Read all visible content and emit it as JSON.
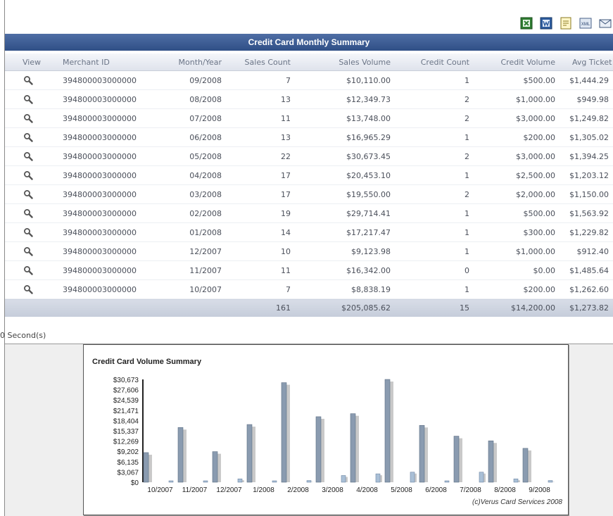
{
  "report": {
    "title": "Credit Card Monthly Summary",
    "elapsed": "0 Second(s)"
  },
  "toolbar": {
    "icons": [
      "excel-icon",
      "word-icon",
      "document-icon",
      "xml-icon",
      "email-icon"
    ],
    "xml_label": "XML"
  },
  "table": {
    "headers": {
      "view": "View",
      "merchant_id": "Merchant ID",
      "month_year": "Month/Year",
      "sales_count": "Sales Count",
      "sales_volume": "Sales Volume",
      "credit_count": "Credit Count",
      "credit_volume": "Credit Volume",
      "avg_ticket": "Avg Ticket"
    },
    "rows": [
      {
        "merchant": "394800003000000",
        "month": "09/2008",
        "sales_count": "7",
        "sales_volume": "$10,110.00",
        "credit_count": "1",
        "credit_volume": "$500.00",
        "avg": "$1,444.29"
      },
      {
        "merchant": "394800003000000",
        "month": "08/2008",
        "sales_count": "13",
        "sales_volume": "$12,349.73",
        "credit_count": "2",
        "credit_volume": "$1,000.00",
        "avg": "$949.98"
      },
      {
        "merchant": "394800003000000",
        "month": "07/2008",
        "sales_count": "11",
        "sales_volume": "$13,748.00",
        "credit_count": "2",
        "credit_volume": "$3,000.00",
        "avg": "$1,249.82"
      },
      {
        "merchant": "394800003000000",
        "month": "06/2008",
        "sales_count": "13",
        "sales_volume": "$16,965.29",
        "credit_count": "1",
        "credit_volume": "$200.00",
        "avg": "$1,305.02"
      },
      {
        "merchant": "394800003000000",
        "month": "05/2008",
        "sales_count": "22",
        "sales_volume": "$30,673.45",
        "credit_count": "2",
        "credit_volume": "$3,000.00",
        "avg": "$1,394.25"
      },
      {
        "merchant": "394800003000000",
        "month": "04/2008",
        "sales_count": "17",
        "sales_volume": "$20,453.10",
        "credit_count": "1",
        "credit_volume": "$2,500.00",
        "avg": "$1,203.12"
      },
      {
        "merchant": "394800003000000",
        "month": "03/2008",
        "sales_count": "17",
        "sales_volume": "$19,550.00",
        "credit_count": "2",
        "credit_volume": "$2,000.00",
        "avg": "$1,150.00"
      },
      {
        "merchant": "394800003000000",
        "month": "02/2008",
        "sales_count": "19",
        "sales_volume": "$29,714.41",
        "credit_count": "1",
        "credit_volume": "$500.00",
        "avg": "$1,563.92"
      },
      {
        "merchant": "394800003000000",
        "month": "01/2008",
        "sales_count": "14",
        "sales_volume": "$17,217.47",
        "credit_count": "1",
        "credit_volume": "$300.00",
        "avg": "$1,229.82"
      },
      {
        "merchant": "394800003000000",
        "month": "12/2007",
        "sales_count": "10",
        "sales_volume": "$9,123.98",
        "credit_count": "1",
        "credit_volume": "$1,000.00",
        "avg": "$912.40"
      },
      {
        "merchant": "394800003000000",
        "month": "11/2007",
        "sales_count": "11",
        "sales_volume": "$16,342.00",
        "credit_count": "0",
        "credit_volume": "$0.00",
        "avg": "$1,485.64"
      },
      {
        "merchant": "394800003000000",
        "month": "10/2007",
        "sales_count": "7",
        "sales_volume": "$8,838.19",
        "credit_count": "1",
        "credit_volume": "$200.00",
        "avg": "$1,262.60"
      }
    ],
    "totals": {
      "sales_count": "161",
      "sales_volume": "$205,085.62",
      "credit_count": "15",
      "credit_volume": "$14,200.00",
      "avg": "$1,273.82"
    }
  },
  "colors": {
    "title_bar": "#2f4f86",
    "bar_front": "#8a9bb0",
    "bar_shadow": "#c9c9c9"
  },
  "chart_data": {
    "type": "bar",
    "title": "Credit Card Volume Summary",
    "copyright": "(c)Verus Card Services 2008",
    "categories": [
      "10/2007",
      "11/2007",
      "12/2007",
      "1/2008",
      "2/2008",
      "3/2008",
      "4/2008",
      "5/2008",
      "6/2008",
      "7/2008",
      "8/2008",
      "9/2008"
    ],
    "series": [
      {
        "values": [
          8838.19,
          16342.0,
          9123.98,
          17217.47,
          29714.41,
          19550.0,
          20453.1,
          30673.45,
          16965.29,
          13748.0,
          12349.73,
          10110.0
        ]
      },
      {
        "values": [
          200.0,
          0.0,
          1000.0,
          300.0,
          500.0,
          2000.0,
          2500.0,
          3000.0,
          200.0,
          3000.0,
          1000.0,
          500.0
        ]
      }
    ],
    "yticks": [
      "$30,673",
      "$27,606",
      "$24,539",
      "$21,471",
      "$18,404",
      "$15,337",
      "$12,269",
      "$9,202",
      "$6,135",
      "$3,067",
      "$0"
    ],
    "ylim": [
      0,
      30673
    ],
    "grid": false
  }
}
